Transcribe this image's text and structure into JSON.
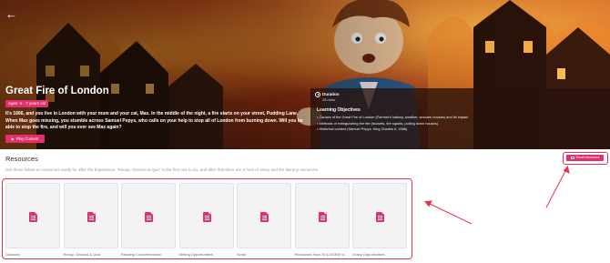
{
  "hero": {
    "back_icon": "arrow-left-icon",
    "title": "Great Fire of London",
    "age_badge": "Ages: 5 - 7 years old",
    "description": "It's 1666, and you live in London with your mum and your cat, Max. In the middle of the night, a fire starts on your street, Pudding Lane. When Max goes missing, you stumble across Samuel Pepys, who calls on your help to stop all of London from burning down. Will you be able to stop the fire, and will you ever see Max again?",
    "play_label": "Play Content",
    "play_icon": "play-icon",
    "accent_color": "#e2306c"
  },
  "info": {
    "duration_icon": "clock-icon",
    "duration_label": "Duration",
    "duration_value": "25 mins",
    "objectives_title": "Learning Objectives",
    "objectives": [
      "Causes of the Great Fire of London (Farriner's bakery, weather, wooden houses) and its impact",
      "Methods of extinguishing the fire (buckets, fire squirts, pulling down houses)",
      "Historical context (Samuel Pepys, King Charles II, 1666)"
    ]
  },
  "resources": {
    "title": "Resources",
    "subtitle": "Get these follow-on resources ready for after the Experience. 'Recap, Discuss & Quiz' is the first one to do, and after that there are a host of oracy and the literacy resources.",
    "email_label": "Email resources",
    "email_icon": "mail-icon",
    "highlight_color": "#e1364a",
    "items": [
      {
        "label": "Glossary",
        "icon": "document-icon"
      },
      {
        "label": "Recap, Discuss & Quiz",
        "icon": "document-icon"
      },
      {
        "label": "Reading Comprehension",
        "icon": "document-icon"
      },
      {
        "label": "Writing Opportunities",
        "icon": "document-icon"
      },
      {
        "label": "Script",
        "icon": "document-icon"
      },
      {
        "label": "Resources How-To & NSEW vi...",
        "icon": "document-icon"
      },
      {
        "label": "Oracy Opportunities",
        "icon": "document-icon"
      }
    ]
  }
}
